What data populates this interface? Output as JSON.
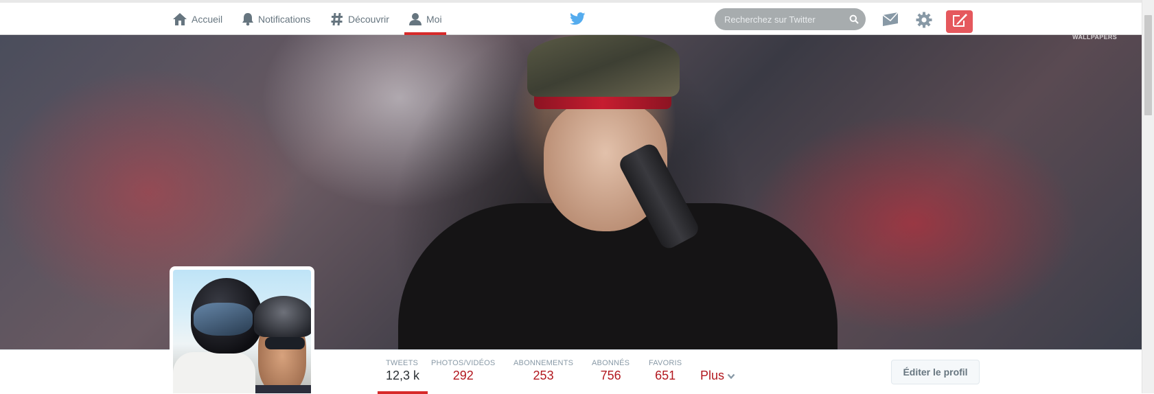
{
  "nav": {
    "home_label": "Accueil",
    "notifications_label": "Notifications",
    "discover_label": "Découvrir",
    "me_label": "Moi"
  },
  "search": {
    "placeholder": "Recherchez sur Twitter"
  },
  "icons": {
    "home": "home-icon",
    "notifications": "bell-icon",
    "discover": "hashtag-icon",
    "me": "user-icon",
    "logo": "twitter-bird-icon",
    "search": "magnifier-icon",
    "messages": "envelope-icon",
    "settings": "gear-icon",
    "compose": "compose-icon",
    "more": "chevron-down-icon"
  },
  "banner": {
    "watermark": "WALLPAPERS"
  },
  "profile_nav": {
    "stats": [
      {
        "label": "TWEETS",
        "value": "12,3 k",
        "active": true
      },
      {
        "label": "PHOTOS/VIDÉOS",
        "value": "292",
        "active": false
      },
      {
        "label": "ABONNEMENTS",
        "value": "253",
        "active": false
      },
      {
        "label": "ABONNÉS",
        "value": "756",
        "active": false
      },
      {
        "label": "FAVORIS",
        "value": "651",
        "active": false
      }
    ],
    "more_label": "Plus",
    "edit_label": "Éditer le profil"
  },
  "colors": {
    "accent": "#d72a2a",
    "stat_value": "#b2171e",
    "compose_button": "#e5585d",
    "twitter_blue": "#55acee",
    "search_bg": "#a7acae"
  }
}
